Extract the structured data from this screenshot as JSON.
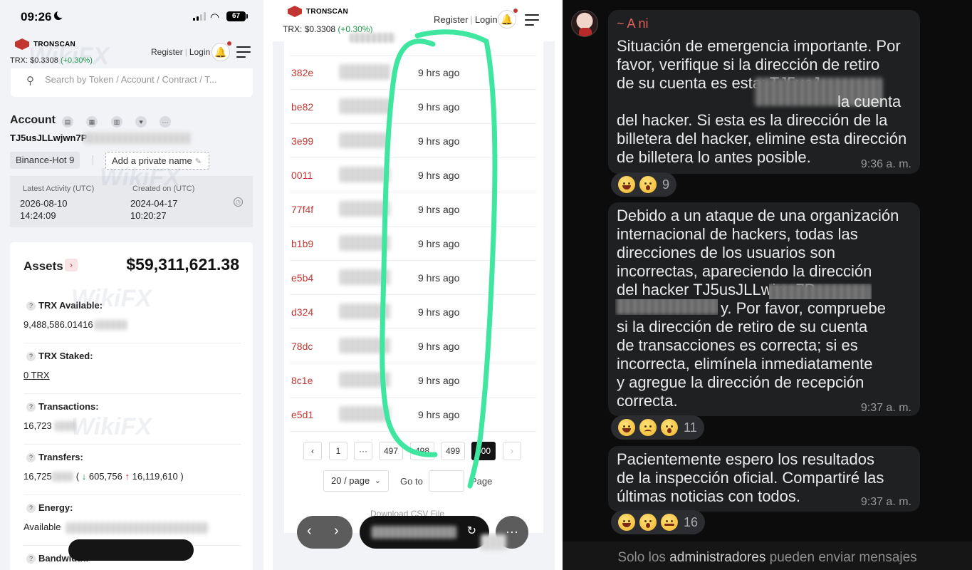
{
  "left_panel": {
    "status_bar": {
      "time": "09:26",
      "battery": "67"
    },
    "brand": "TRONSCAN",
    "trx_price": {
      "label": "TRX:",
      "value": "$0.3308",
      "change": "(+0.30%)"
    },
    "register": "Register",
    "login": "Login",
    "search_placeholder": "Search by Token / Account / Contract / T...",
    "account_title": "Account",
    "account_icons": [
      "copy-icon",
      "qr-icon",
      "chart-icon",
      "heart-icon",
      "more-icon"
    ],
    "address": "TJ5usJLLwjwn7Pv",
    "tag": "Binance-Hot 9",
    "add_private_name": "Add a private name",
    "latest_activity": {
      "label": "Latest Activity (UTC)",
      "date": "2026-08-10",
      "time": "14:24:09"
    },
    "created_on": {
      "label": "Created on (UTC)",
      "date": "2024-04-17",
      "time": "10:20:27"
    },
    "assets_title": "Assets",
    "assets_total": "$59,311,621.38",
    "rows": [
      {
        "label": "TRX Available:",
        "value": "9,488,586.01416"
      },
      {
        "label": "TRX Staked:",
        "value": "0 TRX"
      },
      {
        "label": "Transactions:",
        "value": "16,723"
      },
      {
        "label": "Transfers:",
        "value": "16,725",
        "open": "(",
        "in": "605,756",
        "out": "16,119,610",
        "close": ")"
      },
      {
        "label": "Energy:",
        "value": "Available"
      },
      {
        "label": "Bandwidth:"
      }
    ],
    "watermark": "WikiFX"
  },
  "middle_panel": {
    "brand": "TRONSCAN",
    "trx_price": {
      "label": "TRX:",
      "value": "$0.3308",
      "change": "(+0.30%)"
    },
    "register": "Register",
    "login": "Login",
    "rows": [
      {
        "hash": "382e",
        "age": "9 hrs ago"
      },
      {
        "hash": "be82",
        "age": "9 hrs ago"
      },
      {
        "hash": "3e99",
        "age": "9 hrs ago"
      },
      {
        "hash": "0011",
        "age": "9 hrs ago"
      },
      {
        "hash": "77f4f",
        "age": "9 hrs ago"
      },
      {
        "hash": "b1b9",
        "age": "9 hrs ago"
      },
      {
        "hash": "e5b4",
        "age": "9 hrs ago"
      },
      {
        "hash": "d324",
        "age": "9 hrs ago"
      },
      {
        "hash": "78dc",
        "age": "9 hrs ago"
      },
      {
        "hash": "8c1e",
        "age": "9 hrs ago"
      },
      {
        "hash": "e5d1",
        "age": "9 hrs ago"
      }
    ],
    "pagination": {
      "first": "1",
      "ellipsis": "···",
      "p497": "497",
      "p498": "498",
      "p499": "499",
      "current": "500"
    },
    "per_page": "20 / page",
    "goto_label": "Go to",
    "page_label": "Page",
    "download": "Download CSV File",
    "annotation_color": "#3ee6a0"
  },
  "right_panel": {
    "sender": "~ A ni",
    "messages": [
      {
        "lines": [
          "Situación de emergencia importante. Por",
          "favor, verifique si la dirección de retiro",
          "de su cuenta es esta: TJ5usJ",
          "la cuenta",
          "del hacker. Si esta es la dirección de la",
          "billetera del hacker, elimine esta dirección",
          "de billetera lo antes posible."
        ],
        "time": "9:36 a. m.",
        "reactions": [
          "laugh",
          "wow"
        ],
        "count": "9"
      },
      {
        "lines": [
          "Debido a un ataque de una organización",
          "internacional de hackers, todas las",
          "direcciones de los usuarios son",
          "incorrectas, apareciendo la dirección",
          "del hacker TJ5usJLLwjwn7P",
          "y. Por favor, compruebe",
          "si la dirección de retiro de su cuenta",
          "de transacciones es correcta; si es",
          "incorrecta, elimínela inmediatamente",
          "y agregue la dirección de recepción",
          "correcta."
        ],
        "time": "9:37 a. m.",
        "reactions": [
          "laugh",
          "sad",
          "wow"
        ],
        "count": "11"
      },
      {
        "lines": [
          "Pacientemente espero los resultados",
          "de la inspección oficial. Compartiré las",
          "últimas noticias con todos."
        ],
        "time": "9:37 a. m.",
        "reactions": [
          "laugh",
          "wow",
          "salute"
        ],
        "count": "16"
      }
    ],
    "footer": {
      "pre": "Solo los",
      "highlight": "administradores",
      "post": "pueden enviar mensajes"
    }
  }
}
